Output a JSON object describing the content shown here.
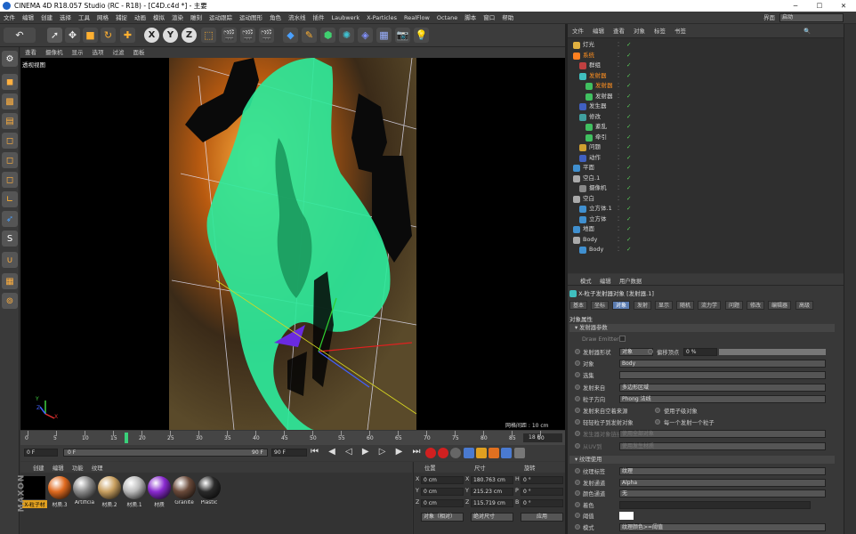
{
  "app": {
    "title": "CINEMA 4D R18.057 Studio (RC - R18) - [C4D.c4d *] - 主要"
  },
  "menu": [
    "文件",
    "编辑",
    "创建",
    "选择",
    "工具",
    "网格",
    "捕捉",
    "动画",
    "模拟",
    "渲染",
    "雕刻",
    "运动跟踪",
    "运动图形",
    "角色",
    "流水线",
    "插件",
    "Laubwerk",
    "X-Particles",
    "RealFlow",
    "Octane",
    "脚本",
    "窗口",
    "帮助"
  ],
  "layout": {
    "label": "界面",
    "value": "启动"
  },
  "viewport": {
    "menu": [
      "查看",
      "摄像机",
      "显示",
      "选项",
      "过滤",
      "面板"
    ],
    "name": "透视视图",
    "grid_label": "网格间距 : 10 cm",
    "axis": {
      "x": "X",
      "y": "Y",
      "z": "Z"
    }
  },
  "timeline": {
    "ticks": [
      "0",
      "5",
      "10",
      "15",
      "20",
      "25",
      "30",
      "35",
      "40",
      "45",
      "50",
      "55",
      "60",
      "65",
      "70",
      "75",
      "80",
      "85",
      "90"
    ],
    "current": "18 F",
    "end": "18 F"
  },
  "transport": {
    "start": "0 F",
    "field2": "0 F",
    "field3": "90 F",
    "field4": "90 F"
  },
  "materials": {
    "menu": [
      "创建",
      "编辑",
      "功能",
      "纹理"
    ],
    "items": [
      {
        "label": "X-粒子材",
        "color": "#111"
      },
      {
        "label": "材质.3",
        "color": "#e06a1f"
      },
      {
        "label": "Artificia",
        "color": "#8a8a8a"
      },
      {
        "label": "材质.2",
        "color": "#c9a060"
      },
      {
        "label": "材质.1",
        "color": "#bbbbbb"
      },
      {
        "label": "材质",
        "color": "#8a2ad0"
      },
      {
        "label": "Granite",
        "color": "#6a4a3a"
      },
      {
        "label": "Plastic",
        "color": "#2a2a2a"
      }
    ]
  },
  "coords": {
    "headers": [
      "位置",
      "尺寸",
      "旋转"
    ],
    "rows": [
      {
        "axis": "X",
        "pos": "0 cm",
        "size": "180.763 cm",
        "rl": "H",
        "rot": "0 °"
      },
      {
        "axis": "Y",
        "pos": "0 cm",
        "size": "215.23 cm",
        "rl": "P",
        "rot": "0 °"
      },
      {
        "axis": "Z",
        "pos": "0 cm",
        "size": "115.719 cm",
        "rl": "B",
        "rot": "0 °"
      }
    ],
    "mode1": "对象（相对）",
    "mode2": "绝对尺寸",
    "apply": "应用"
  },
  "objects": {
    "menu": [
      "文件",
      "编辑",
      "查看",
      "对象",
      "标签",
      "书签"
    ],
    "items": [
      {
        "name": "灯光",
        "indent": 0,
        "color": "#d8d8d8",
        "icon": "#e0b040"
      },
      {
        "name": "系统",
        "indent": 0,
        "color": "#ff9020",
        "icon": "#ff8020"
      },
      {
        "name": "群组",
        "indent": 1,
        "color": "#d8d8d8",
        "icon": "#c04040"
      },
      {
        "name": "发射器",
        "indent": 1,
        "color": "#ff9020",
        "icon": "#40c0c0"
      },
      {
        "name": "发射器",
        "indent": 2,
        "color": "#ff9020",
        "icon": "#40c060"
      },
      {
        "name": "发射器",
        "indent": 2,
        "color": "#d8d8d8",
        "icon": "#40c060"
      },
      {
        "name": "发生器",
        "indent": 1,
        "color": "#d8d8d8",
        "icon": "#4060c0"
      },
      {
        "name": "修改",
        "indent": 1,
        "color": "#d8d8d8",
        "icon": "#40a0a0"
      },
      {
        "name": "紊乱",
        "indent": 2,
        "color": "#d8d8d8",
        "icon": "#40c060"
      },
      {
        "name": "牵引",
        "indent": 2,
        "color": "#d8d8d8",
        "icon": "#40c060"
      },
      {
        "name": "问题",
        "indent": 1,
        "color": "#d8d8d8",
        "icon": "#d0a030"
      },
      {
        "name": "动作",
        "indent": 1,
        "color": "#d8d8d8",
        "icon": "#4060c0"
      },
      {
        "name": "平面",
        "indent": 0,
        "color": "#d8d8d8",
        "icon": "#4090d0"
      },
      {
        "name": "空白.1",
        "indent": 0,
        "color": "#d8d8d8",
        "icon": "#aaaaaa"
      },
      {
        "name": "摄像机",
        "indent": 1,
        "color": "#d8d8d8",
        "icon": "#888888"
      },
      {
        "name": "空白",
        "indent": 0,
        "color": "#d8d8d8",
        "icon": "#aaaaaa"
      },
      {
        "name": "立方体.1",
        "indent": 1,
        "color": "#d8d8d8",
        "icon": "#4090d0"
      },
      {
        "name": "立方体",
        "indent": 1,
        "color": "#d8d8d8",
        "icon": "#4090d0"
      },
      {
        "name": "地面",
        "indent": 0,
        "color": "#d8d8d8",
        "icon": "#4090d0"
      },
      {
        "name": "Body",
        "indent": 0,
        "color": "#d8d8d8",
        "icon": "#aaaaaa"
      },
      {
        "name": "Body",
        "indent": 1,
        "color": "#d8d8d8",
        "icon": "#4090d0"
      }
    ]
  },
  "attributes": {
    "menu": [
      "模式",
      "编辑",
      "用户数据"
    ],
    "title": "X-粒子发射器对象 [发射器.1]",
    "tabs": [
      "基本",
      "坐标",
      "对象",
      "发射",
      "显示",
      "随机",
      "流力学",
      "问题",
      "修改",
      "编辑器",
      "高级"
    ],
    "active_tab": "对象",
    "section": "对象属性",
    "sub1": "发射器参数",
    "draw_emitter": "Draw Emitter",
    "rows": [
      {
        "label": "发射器形状",
        "value": "对象",
        "extra_label": "偏移顶点",
        "extra_value": "0 %"
      },
      {
        "label": "对象",
        "value": "Body"
      },
      {
        "label": "选集",
        "value": ""
      },
      {
        "label": "发射来自",
        "value": "多边形区域"
      },
      {
        "label": "粒子方向",
        "value": "Phong 法线"
      },
      {
        "label": "发射来自空着来源",
        "value": "",
        "extra_label": "使用子级对象"
      },
      {
        "label": "轻轻粒子到发射对象",
        "value": "",
        "extra_label": "每一个发射一个粒子"
      },
      {
        "label": "发生器对象链接",
        "value": "使用全部对象"
      },
      {
        "label": "从UV到",
        "value": "使用发生材质"
      }
    ],
    "sub2": "纹理使用",
    "tex_rows": [
      {
        "label": "纹理标签",
        "value": "纹理"
      },
      {
        "label": "发射通道",
        "value": "Alpha"
      },
      {
        "label": "颜色通道",
        "value": "无"
      },
      {
        "label": "着色",
        "value": ""
      },
      {
        "label": "阈值",
        "value": ""
      },
      {
        "label": "模式",
        "value": "纹理颜色>=阈值"
      }
    ]
  }
}
